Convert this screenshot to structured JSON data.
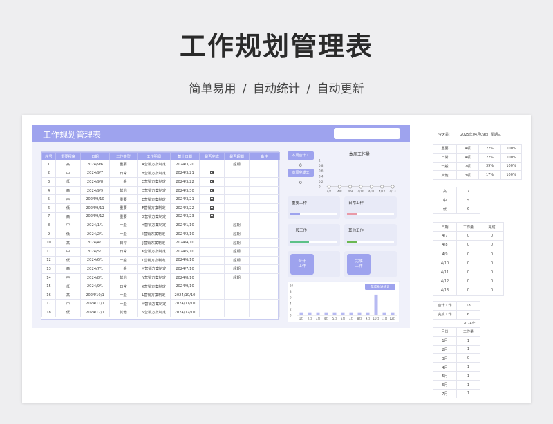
{
  "hero": {
    "title": "工作规划管理表",
    "subtitle": "简单易用  /  自动统计  /  自动更新"
  },
  "sheet": {
    "title": "工作规划管理表",
    "columns": [
      "序号",
      "重要程度",
      "日期",
      "工作类型",
      "工作明细",
      "截止日期",
      "是否完成",
      "是否超期",
      "备注"
    ],
    "rows": [
      [
        "1",
        "高",
        "2024/9/6",
        "重要",
        "A营销方案制定",
        "2024/3/20",
        "",
        "超期",
        ""
      ],
      [
        "2",
        "中",
        "2024/9/7",
        "日常",
        "B营销方案制定",
        "2024/3/21",
        "✓",
        "",
        ""
      ],
      [
        "3",
        "低",
        "2024/9/8",
        "一般",
        "C营销方案制定",
        "2024/3/22",
        "✓",
        "",
        ""
      ],
      [
        "4",
        "高",
        "2024/9/9",
        "其他",
        "D营销方案制定",
        "2024/3/30",
        "✓",
        "",
        ""
      ],
      [
        "5",
        "中",
        "2024/9/10",
        "重要",
        "E营销方案制定",
        "2024/3/21",
        "✓",
        "",
        ""
      ],
      [
        "6",
        "低",
        "2024/9/11",
        "重要",
        "F营销方案制定",
        "2024/3/22",
        "✓",
        "",
        ""
      ],
      [
        "7",
        "高",
        "2024/9/12",
        "重要",
        "G营销方案制定",
        "2024/3/23",
        "✓",
        "",
        ""
      ],
      [
        "8",
        "中",
        "2024/1/1",
        "一般",
        "H营销方案制定",
        "2024/1/10",
        "",
        "超期",
        ""
      ],
      [
        "9",
        "低",
        "2024/2/1",
        "一般",
        "I营销方案制定",
        "2024/2/10",
        "",
        "超期",
        ""
      ],
      [
        "10",
        "高",
        "2024/4/1",
        "日常",
        "J营销方案制定",
        "2024/4/10",
        "",
        "超期",
        ""
      ],
      [
        "11",
        "中",
        "2024/5/1",
        "日常",
        "K营销方案制定",
        "2024/5/10",
        "",
        "超期",
        ""
      ],
      [
        "12",
        "低",
        "2024/6/1",
        "一般",
        "L营销方案制定",
        "2024/6/10",
        "",
        "超期",
        ""
      ],
      [
        "13",
        "高",
        "2024/7/1",
        "一般",
        "M营销方案制定",
        "2024/7/10",
        "",
        "超期",
        ""
      ],
      [
        "14",
        "中",
        "2024/8/1",
        "其他",
        "N营销方案制定",
        "2024/8/10",
        "",
        "超期",
        ""
      ],
      [
        "15",
        "低",
        "2024/9/1",
        "日常",
        "K营销方案制定",
        "2024/9/10",
        "",
        "",
        ""
      ],
      [
        "16",
        "高",
        "2024/10/1",
        "一般",
        "L营销方案制定",
        "2024/10/10",
        "",
        "",
        ""
      ],
      [
        "17",
        "中",
        "2024/11/1",
        "一般",
        "M营销方案制定",
        "2024/11/10",
        "",
        "",
        ""
      ],
      [
        "18",
        "低",
        "2024/12/1",
        "其他",
        "N营销方案制定",
        "2024/12/10",
        "",
        "",
        ""
      ]
    ]
  },
  "dashboard": {
    "week_total_label": "本周合计工",
    "week_total_value": "0",
    "week_done_label": "本周完成工",
    "week_done_value": "0",
    "week_chart_title": "本周工作量",
    "week_chart": {
      "type": "line",
      "x": [
        "4/7",
        "4/8",
        "4/9",
        "4/10",
        "4/11",
        "4/12",
        "4/13"
      ],
      "y": [
        0,
        0,
        0,
        0,
        0,
        0,
        0
      ],
      "yticks": [
        "1",
        "0.8",
        "0.6",
        "0.4",
        "0.2",
        "0"
      ],
      "ylim": [
        0,
        1
      ]
    },
    "cards": [
      {
        "label": "重要工作",
        "color": "#9ea3ee",
        "fill": 0.2
      },
      {
        "label": "日常工作",
        "color": "#ea9aa7",
        "fill": 0.2
      },
      {
        "label": "一般工作",
        "color": "#5cc187",
        "fill": 0.4
      },
      {
        "label": "其他工作",
        "color": "#6bb852",
        "fill": 0.2
      }
    ],
    "btn_total": "合计\n工作",
    "btn_done": "完成\n工作",
    "year_chart": {
      "type": "bar",
      "legend": "年度推进统计",
      "categories": [
        "1月",
        "2月",
        "3月",
        "4月",
        "5月",
        "6月",
        "7月",
        "8月",
        "9月",
        "10月",
        "11月",
        "12月"
      ],
      "values": [
        1,
        1,
        1,
        1,
        1,
        1,
        1,
        1,
        1,
        7,
        1,
        1
      ],
      "yticks": [
        "10",
        "8",
        "6",
        "4",
        "2",
        "0"
      ],
      "ylim": [
        0,
        10
      ]
    }
  },
  "side": {
    "today_label": "今天是:",
    "today_date": "2025年04月09日",
    "today_weekday": "星期三",
    "type_stats": [
      [
        "重要",
        "4项",
        "22%",
        "100%"
      ],
      [
        "日常",
        "4项",
        "22%",
        "100%"
      ],
      [
        "一般",
        "7项",
        "39%",
        "100%"
      ],
      [
        "其他",
        "3项",
        "17%",
        "100%"
      ]
    ],
    "level_stats": [
      [
        "高",
        "7"
      ],
      [
        "中",
        "5"
      ],
      [
        "低",
        "6"
      ]
    ],
    "date_header": [
      "日期",
      "工作量",
      "完成"
    ],
    "date_stats": [
      [
        "4/7",
        "0",
        "0"
      ],
      [
        "4/8",
        "0",
        "0"
      ],
      [
        "4/9",
        "0",
        "0"
      ],
      [
        "4/10",
        "0",
        "0"
      ],
      [
        "4/11",
        "0",
        "0"
      ],
      [
        "4/12",
        "0",
        "0"
      ],
      [
        "4/13",
        "0",
        "0"
      ]
    ],
    "totals": [
      [
        "合计工作",
        "18"
      ],
      [
        "完成工作",
        "6"
      ]
    ],
    "year_label": "2024年",
    "month_header": [
      "月份",
      "工作量"
    ],
    "month_stats": [
      [
        "1月",
        "1"
      ],
      [
        "2月",
        "1"
      ],
      [
        "3月",
        "0"
      ],
      [
        "4月",
        "1"
      ],
      [
        "5月",
        "1"
      ],
      [
        "6月",
        "1"
      ],
      [
        "7月",
        "1"
      ]
    ]
  }
}
